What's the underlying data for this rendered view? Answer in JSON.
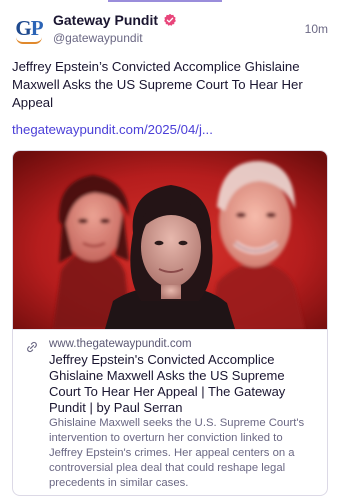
{
  "post": {
    "author": {
      "name": "Gateway Pundit",
      "handle": "@gatewaypundit",
      "avatar_text": "GP",
      "verified_icon": "verified-badge-icon"
    },
    "time": "10m",
    "text": "Jeffrey Epstein’s Convicted Accomplice Ghislaine Maxwell Asks the US Supreme Court To Hear Her Appeal",
    "link": "thegatewaypundit.com/2025/04/j..."
  },
  "card": {
    "domain": "www.thegatewaypundit.com",
    "title": "Jeffrey Epstein's Convicted Accomplice Ghislaine Maxwell Asks the US Supreme Court To Hear Her Appeal | The Gateway Pundit | by Paul Serran",
    "description": "Ghislaine Maxwell seeks the U.S. Supreme Court's intervention to overturn her conviction linked to Jeffrey Epstein's crimes. Her appeal centers on a controversial plea deal that could reshape legal precedents in similar cases.",
    "link_icon": "link-icon"
  },
  "colors": {
    "accent": "#4b3fd8",
    "verified": "#e8457a",
    "card_image_red": "#b51d1d"
  }
}
